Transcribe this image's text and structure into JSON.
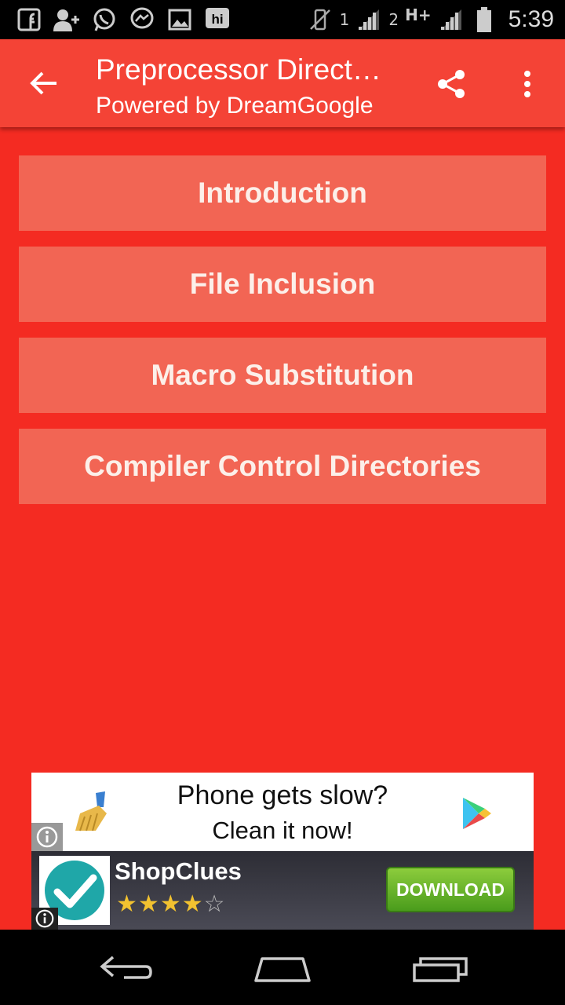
{
  "status_bar": {
    "time": "5:39",
    "sim1_label": "1",
    "sim2_label": "2",
    "network_type": "H+",
    "icons": [
      "facebook-notification-icon",
      "add-contact-icon",
      "whatsapp-icon",
      "messenger-icon",
      "gallery-icon",
      "hike-icon",
      "vibrate-off-icon",
      "signal-icon",
      "signal-icon",
      "battery-icon"
    ]
  },
  "app_bar": {
    "title": "Preprocessor Direct…",
    "subtitle": "Powered by DreamGoogle"
  },
  "menu": {
    "items": [
      {
        "label": "Introduction"
      },
      {
        "label": "File Inclusion"
      },
      {
        "label": "Macro Substitution"
      },
      {
        "label": "Compiler Control Directories"
      }
    ]
  },
  "ad": {
    "headline": "Phone gets slow?",
    "subline": "Clean it now!",
    "app_name": "ShopClues",
    "rating": 4,
    "rating_max": 5,
    "cta_label": "DOWNLOAD"
  },
  "colors": {
    "background": "#f42b22",
    "app_bar": "#f44336",
    "menu_button": "#f26554"
  }
}
